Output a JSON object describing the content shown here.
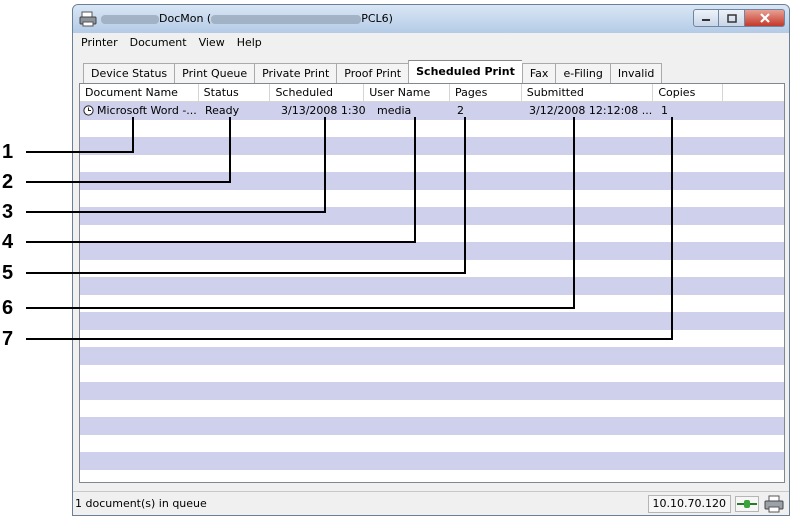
{
  "window": {
    "title_prefix": "DocMon (",
    "title_suffix": "PCL6)"
  },
  "menu": [
    "Printer",
    "Document",
    "View",
    "Help"
  ],
  "tabs": [
    {
      "label": "Device Status",
      "active": false
    },
    {
      "label": "Print Queue",
      "active": false
    },
    {
      "label": "Private Print",
      "active": false
    },
    {
      "label": "Proof Print",
      "active": false
    },
    {
      "label": "Scheduled Print",
      "active": true
    },
    {
      "label": "Fax",
      "active": false
    },
    {
      "label": "e-Filing",
      "active": false
    },
    {
      "label": "Invalid",
      "active": false
    }
  ],
  "columns": [
    "Document Name",
    "Status",
    "Scheduled",
    "User Name",
    "Pages",
    "Submitted",
    "Copies"
  ],
  "rows": [
    [
      "Microsoft Word -...",
      "Ready",
      "3/13/2008 1:30:...",
      "media",
      "2",
      "3/12/2008 12:12:08 ...",
      "1"
    ]
  ],
  "status": {
    "text": "1 document(s) in queue",
    "ip": "10.10.70.120"
  },
  "callouts": [
    "1",
    "2",
    "3",
    "4",
    "5",
    "6",
    "7"
  ],
  "colors": {
    "row_stripe": "#cfd1ec",
    "title_bar": "#bcd0e8",
    "close_button": "#c4382a"
  }
}
